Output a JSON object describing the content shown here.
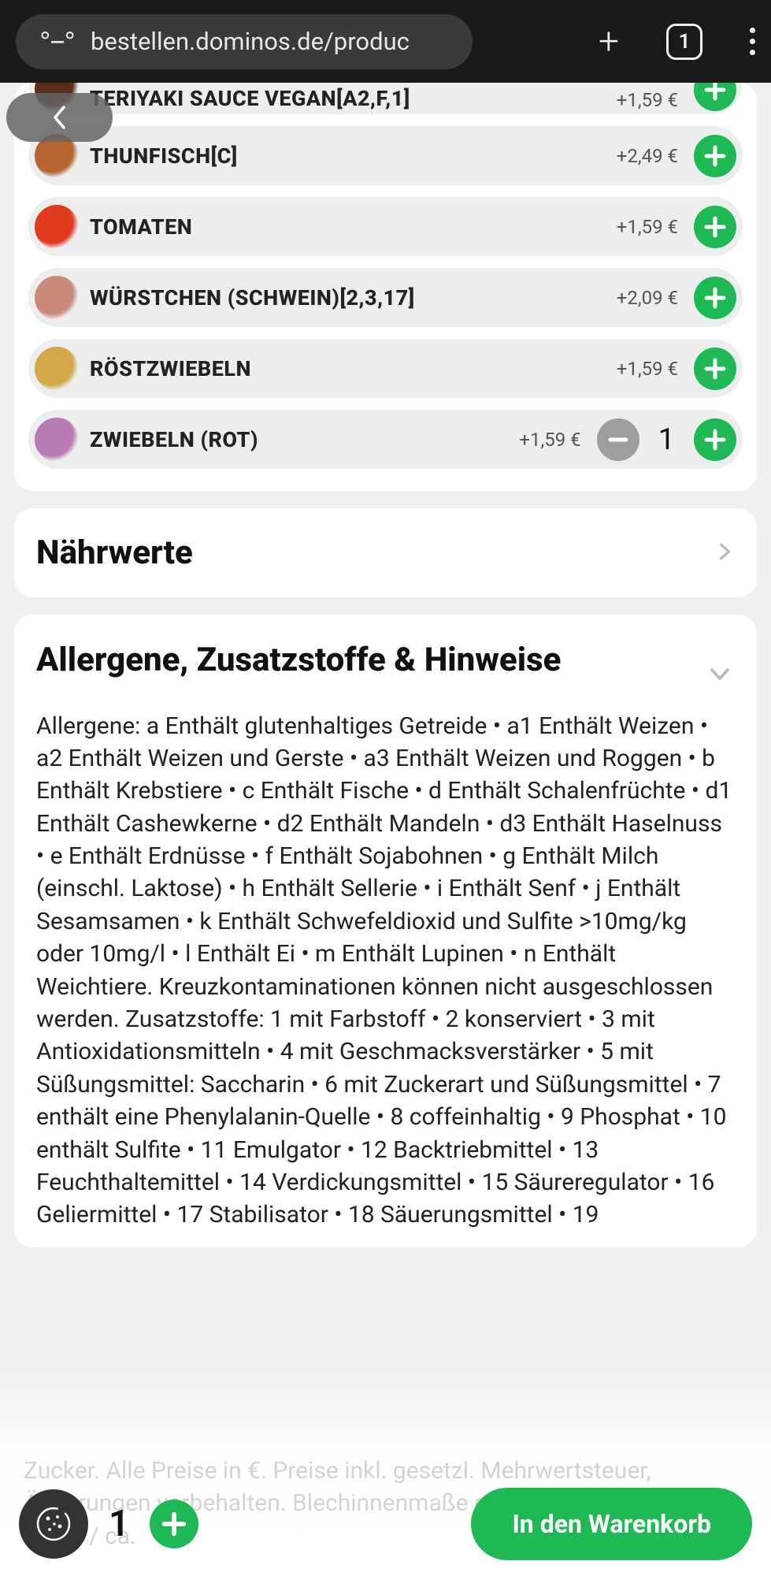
{
  "browser": {
    "url": "bestellen.dominos.de/produc",
    "tab_count": "1"
  },
  "toppings": [
    {
      "name": "TERIYAKI SAUCE VEGAN[A2,F,1]",
      "price": "+1,59 €",
      "color": "#5a2e1a",
      "qty": null,
      "cut": true
    },
    {
      "name": "THUNFISCH[C]",
      "price": "+2,49 €",
      "color": "#b7652f",
      "qty": null
    },
    {
      "name": "TOMATEN",
      "price": "+1,59 €",
      "color": "#e13b1f",
      "qty": null
    },
    {
      "name": "WÜRSTCHEN (SCHWEIN)[2,3,17]",
      "price": "+2,09 €",
      "color": "#c98a7a",
      "qty": null
    },
    {
      "name": "RÖSTZWIEBELN",
      "price": "+1,59 €",
      "color": "#d4a84a",
      "qty": null
    },
    {
      "name": "ZWIEBELN (ROT)",
      "price": "+1,59 €",
      "color": "#b97bb3",
      "qty": "1"
    }
  ],
  "sections": {
    "nutrition": "Nährwerte",
    "allergens_title": "Allergene, Zusatzstoffe & Hinweise",
    "allergens_body": "Allergene: a Enthält glutenhaltiges Getreide • a1 Enthält Weizen • a2 Enthält Weizen und Gerste • a3 Enthält Weizen und Roggen • b Enthält Krebstiere • c Enthält Fische • d Enthält Schalenfrüchte • d1 Enthält Cashewkerne • d2 Enthält Mandeln • d3 Enthält Haselnuss • e Enthält Erdnüsse • f Enthält Sojabohnen • g Enthält Milch (einschl. Laktose) • h Enthält Sellerie • i Enthält Senf • j Enthält Sesamsamen • k Enthält Schwefeldioxid und Sulfite >10mg/kg oder 10mg/l • l Enthält Ei • m Enthält Lupinen • n Enthält Weichtiere. Kreuzkontaminationen können nicht ausgeschlossen werden. Zusatzstoffe: 1 mit Farbstoff • 2 konserviert • 3 mit Antioxidationsmitteln • 4 mit Geschmacksverstärker • 5 mit Süßungsmittel: Saccharin • 6 mit Zuckerart und Süßungsmittel • 7 enthält eine Phenylalanin-Quelle • 8 coffeinhaltig • 9 Phosphat • 10 enthält Sulfite • 11 Emulgator • 12 Backtriebmittel • 13 Feuchthaltemittel • 14 Verdickungsmittel • 15 Säureregulator • 16 Geliermittel • 17 Stabilisator • 18 Säuerungsmittel • 19"
  },
  "faded_lines": "Zucker. Alle Preise in €. Preise inkl. gesetzl. Mehrwertsteuer, Änderungen vorbehalten. Blechinnenmaße gerundet (ca. 25cm / ca. 28cm / ca.",
  "footer": {
    "qty": "1",
    "cart_label": "In den Warenkorb"
  }
}
